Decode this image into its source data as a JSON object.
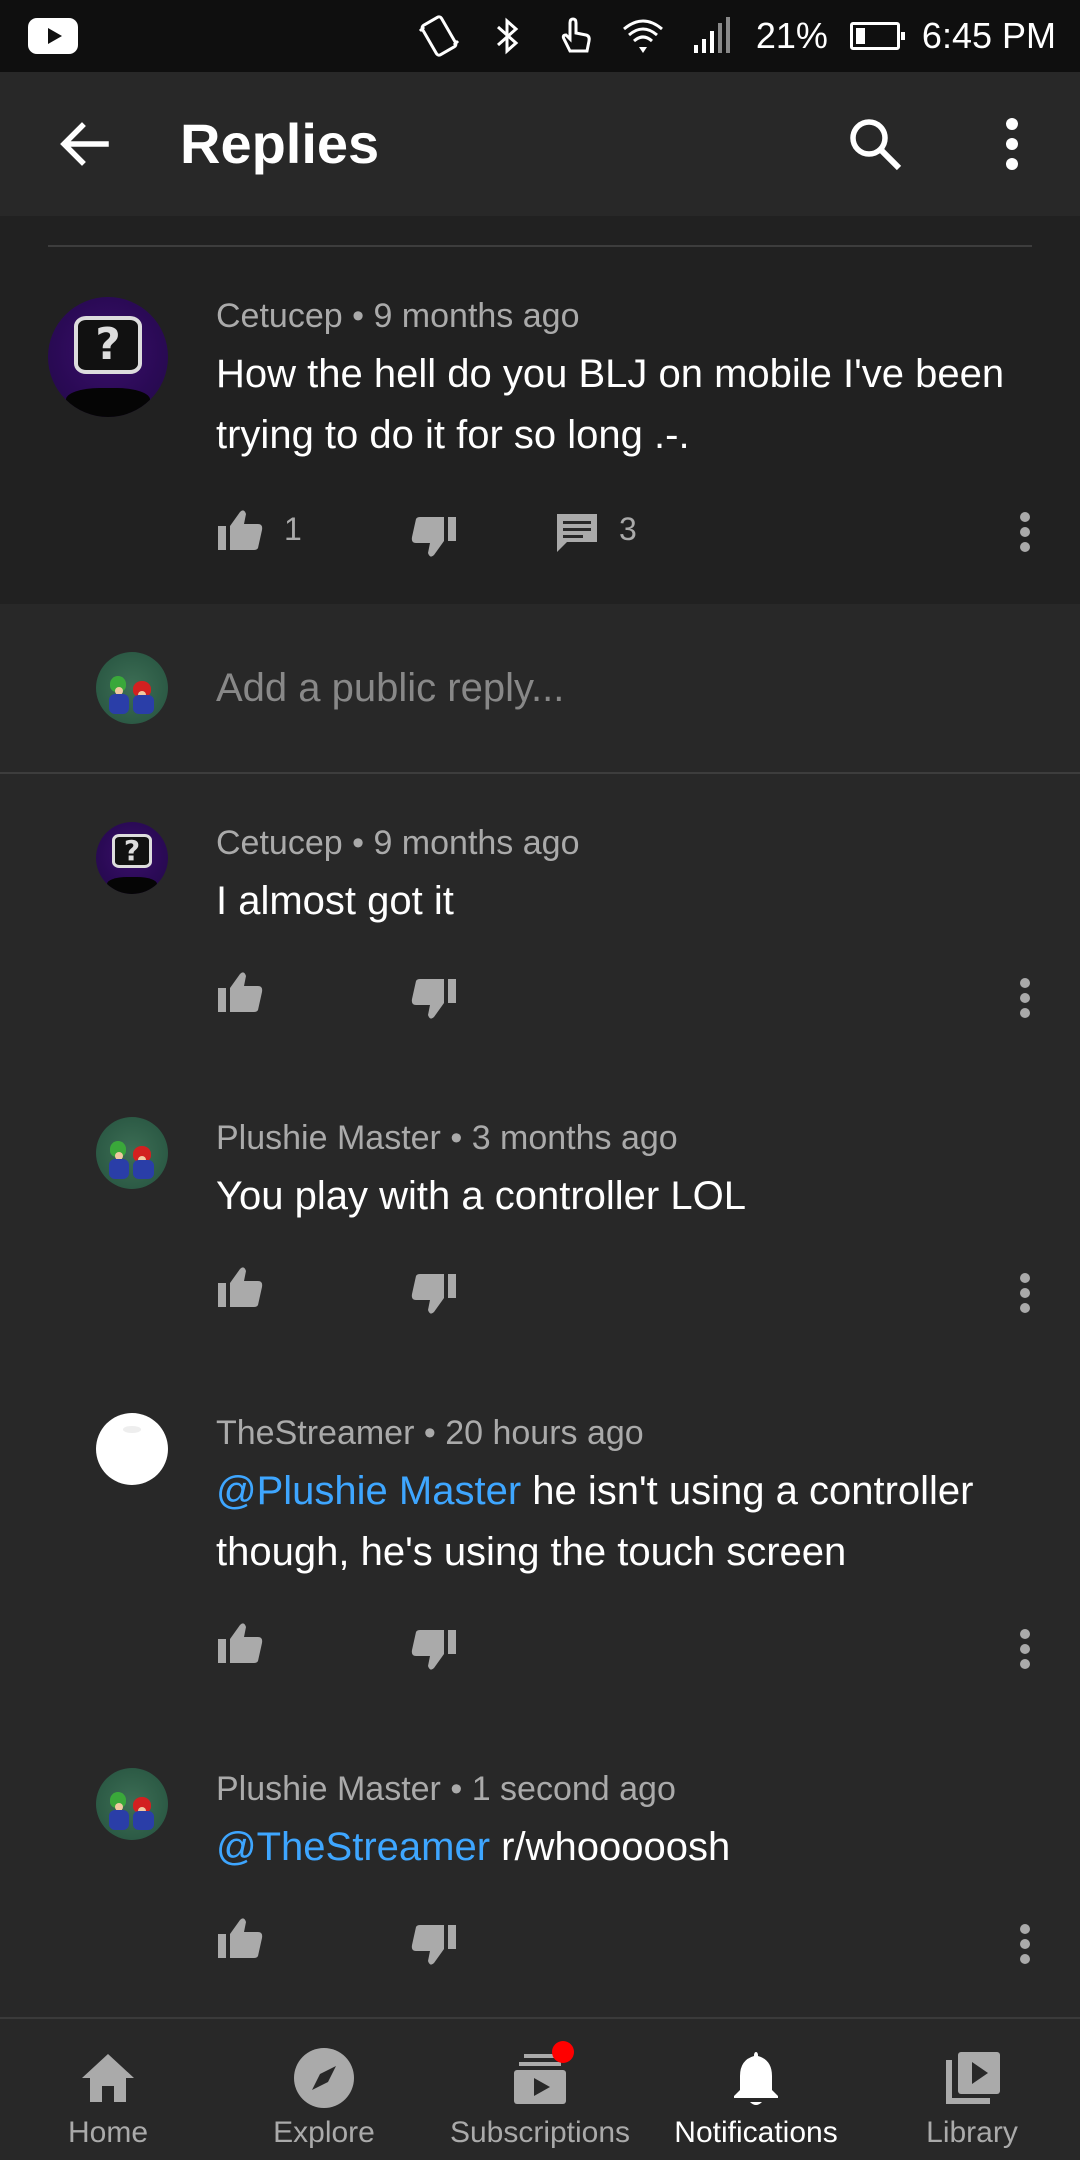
{
  "status_bar": {
    "battery_percent": "21%",
    "time": "6:45 PM",
    "icons": [
      "youtube-icon",
      "vibrate-icon",
      "bluetooth-icon",
      "touch-icon",
      "wifi-icon",
      "signal-icon",
      "battery-icon"
    ]
  },
  "app_bar": {
    "title": "Replies",
    "icons": [
      "back-arrow-icon",
      "search-icon",
      "more-vert-icon"
    ]
  },
  "top_comment": {
    "author": "Cetucep",
    "age": "9 months ago",
    "text": "How the hell do you BLJ on mobile I've been trying to do it for so long .-.",
    "likes": "1",
    "replies": "3",
    "avatar": "question-monitor-avatar"
  },
  "reply_input": {
    "placeholder": "Add a public reply..."
  },
  "replies": [
    {
      "author": "Cetucep",
      "age": "9 months ago",
      "text": "I almost got it",
      "avatar": "question-monitor-avatar"
    },
    {
      "author": "Plushie Master",
      "age": "3 months ago",
      "text": "You play with a controller LOL",
      "avatar": "mario-luigi-avatar"
    },
    {
      "author": "TheStreamer",
      "age": "20 hours ago",
      "mention": "@Plushie Master",
      "text": " he isn't using a controller though, he's using the touch screen",
      "avatar": "white-avatar"
    },
    {
      "author": "Plushie Master",
      "age": "1 second ago",
      "mention": "@TheStreamer",
      "text": " r/whooooosh",
      "avatar": "mario-luigi-avatar"
    }
  ],
  "separator": "•",
  "bottom_nav": {
    "items": [
      {
        "label": "Home",
        "icon": "home-icon"
      },
      {
        "label": "Explore",
        "icon": "compass-icon"
      },
      {
        "label": "Subscriptions",
        "icon": "subscriptions-icon"
      },
      {
        "label": "Notifications",
        "icon": "bell-icon"
      },
      {
        "label": "Library",
        "icon": "library-icon"
      }
    ],
    "active": "Notifications"
  },
  "colors": {
    "background": "#282828",
    "top_comment_bg": "#212121",
    "meta_text": "#aaaaaa",
    "mention": "#3ea6ff",
    "badge": "#ff0000"
  }
}
